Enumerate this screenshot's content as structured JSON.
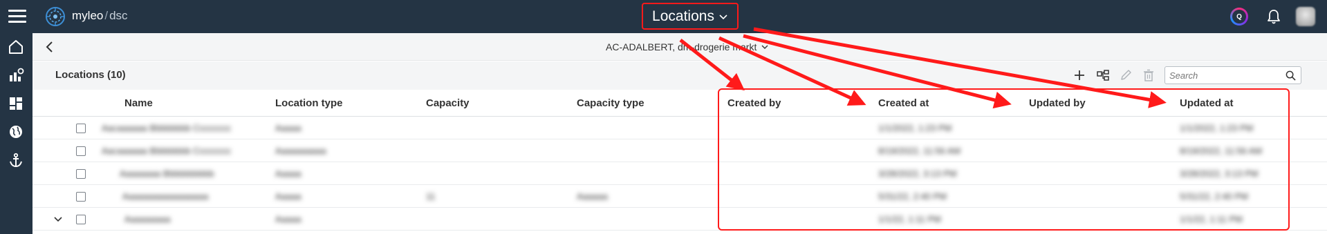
{
  "topbar": {
    "brand_name": "myleo",
    "brand_separator": "/",
    "brand_sub": "dsc",
    "page_title": "Locations",
    "assistant_badge": "Q"
  },
  "subheader": {
    "context_label": "AC-ADALBERT, dm-drogerie markt"
  },
  "toolbar": {
    "list_title": "Locations (10)",
    "search_placeholder": "Search"
  },
  "table": {
    "columns": [
      "Name",
      "Location type",
      "Capacity",
      "Capacity type",
      "Created by",
      "Created at",
      "Updated by",
      "Updated at"
    ],
    "rows": [
      {
        "name": "Aacaaaaaa Bbbbbbbb Cccccccc",
        "location_type": "Aaaaa",
        "capacity": "",
        "capacity_type": "",
        "created_by": "",
        "created_at": "1/1/2022, 1:23 PM",
        "updated_by": "",
        "updated_at": "1/1/2022, 1:23 PM",
        "expandable": false
      },
      {
        "name": "Aacaaaaaa Bbbbbbbb Cccccccc",
        "location_type": "Aaaaaaaaaa",
        "capacity": "",
        "capacity_type": "",
        "created_by": "",
        "created_at": "8/19/2022, 11:56 AM",
        "updated_by": "",
        "updated_at": "8/19/2022, 11:56 AM",
        "expandable": false
      },
      {
        "name": "Aaaaaaaa Bbbbbbbbbb",
        "location_type": "Aaaaa",
        "capacity": "",
        "capacity_type": "",
        "created_by": "",
        "created_at": "3/28/2022, 3:13 PM",
        "updated_by": "",
        "updated_at": "3/28/2022, 3:13 PM",
        "expandable": false
      },
      {
        "name": "Aaaaaaaaaaaaaaaaa",
        "location_type": "Aaaaa",
        "capacity": "11",
        "capacity_type": "Aaaaaa",
        "created_by": "",
        "created_at": "5/31/22, 2:40 PM",
        "updated_by": "",
        "updated_at": "5/31/22, 2:40 PM",
        "expandable": false
      },
      {
        "name": "Aaaaaaaaa",
        "location_type": "Aaaaa",
        "capacity": "",
        "capacity_type": "",
        "created_by": "",
        "created_at": "1/1/22, 1:11 PM",
        "updated_by": "",
        "updated_at": "1/1/22, 1:11 PM",
        "expandable": true
      }
    ]
  },
  "colors": {
    "topbar_bg": "#243444",
    "annotation_red": "#ff1a1a",
    "toolbar_bg": "#f4f5f6"
  },
  "icons": [
    "menu-icon",
    "logo-icon",
    "chevron-down-icon",
    "assistant-icon",
    "bell-icon",
    "home-icon",
    "analytics-icon",
    "dashboard-icon",
    "globe-icon",
    "anchor-icon",
    "back-icon",
    "add-icon",
    "hierarchy-icon",
    "edit-icon",
    "delete-icon",
    "search-icon",
    "checkbox-icon"
  ]
}
